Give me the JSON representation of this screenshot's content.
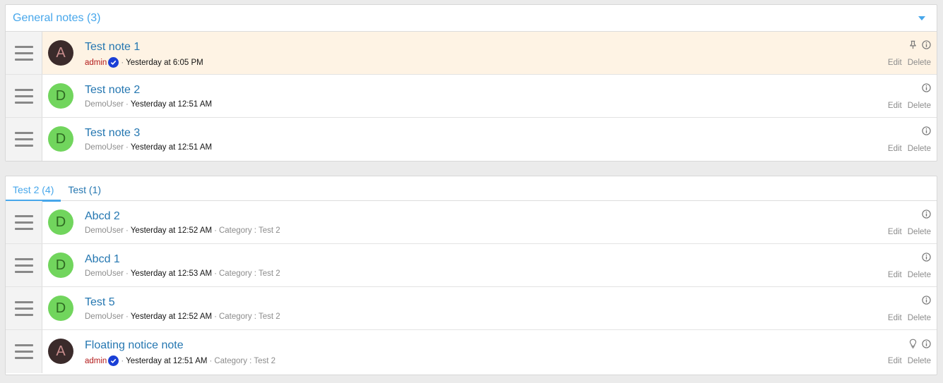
{
  "general": {
    "title": "General notes (3)",
    "notes": [
      {
        "title": "Test note 1",
        "user": "admin",
        "time": "Yesterday at 6:05 PM"
      },
      {
        "title": "Test note 2",
        "user": "DemoUser",
        "time": "Yesterday at 12:51 AM"
      },
      {
        "title": "Test note 3",
        "user": "DemoUser",
        "time": "Yesterday at 12:51 AM"
      }
    ]
  },
  "tabs": {
    "items": [
      {
        "label": "Test 2 (4)"
      },
      {
        "label": "Test (1)"
      }
    ]
  },
  "category": {
    "notes": [
      {
        "title": "Abcd 2",
        "user": "DemoUser",
        "time": "Yesterday at 12:52 AM",
        "category": "Category : Test 2"
      },
      {
        "title": "Abcd 1",
        "user": "DemoUser",
        "time": "Yesterday at 12:53 AM",
        "category": "Category : Test 2"
      },
      {
        "title": "Test 5",
        "user": "DemoUser",
        "time": "Yesterday at 12:52 AM",
        "category": "Category : Test 2"
      },
      {
        "title": "Floating notice note",
        "user": "admin",
        "time": "Yesterday at 12:51 AM",
        "category": "Category : Test 2"
      }
    ]
  },
  "avatars": {
    "a": "A",
    "d": "D"
  },
  "labels": {
    "edit": "Edit",
    "delete": "Delete",
    "separator": "·"
  },
  "colors": {
    "accent": "#47a7eb",
    "link": "#2577b1",
    "highlight_row": "#fef3e4",
    "avatar_demo": "#71d55d",
    "avatar_admin": "#3b2b2b",
    "admin_name": "#b31b1b",
    "verified_badge": "#1a3fd6"
  },
  "icons": {
    "info": "info-icon",
    "pin": "pin-icon",
    "bulb": "lightbulb-icon",
    "verified": "verified-badge-icon",
    "collapse": "caret-down-icon",
    "handle": "drag-handle-icon"
  }
}
